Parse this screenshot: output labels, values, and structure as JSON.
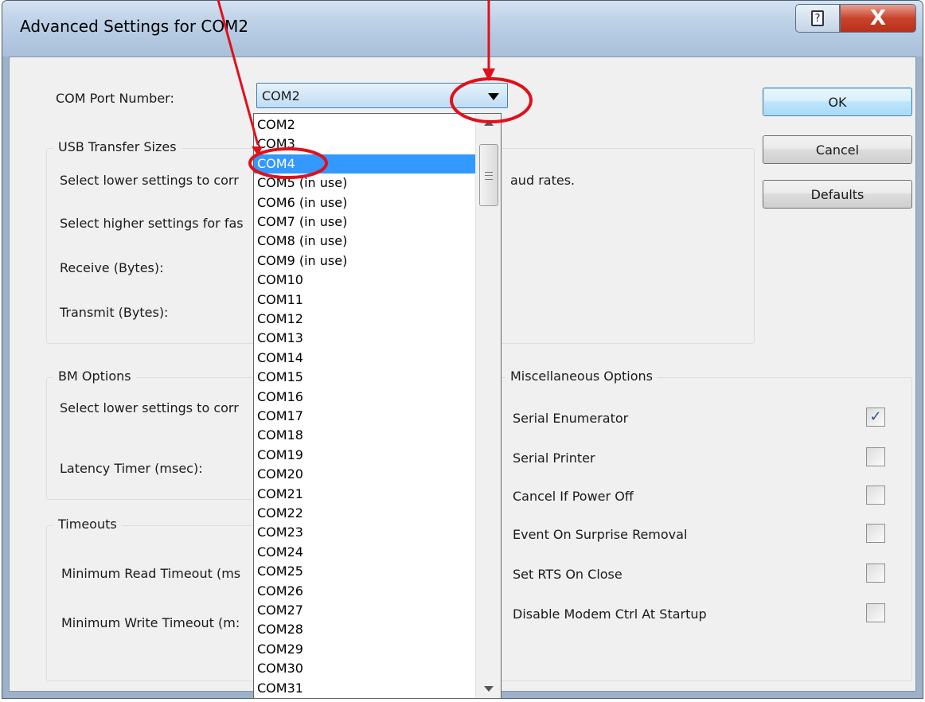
{
  "window": {
    "title": "Advanced Settings for COM2",
    "help_icon": "help-icon",
    "close_icon": "close-icon",
    "help_glyph": "?",
    "close_glyph": "X"
  },
  "com_port": {
    "label": "COM Port Number:",
    "selected": "COM2",
    "highlighted_option": "COM4",
    "options": [
      "COM2",
      "COM3",
      "COM4",
      "COM5 (in use)",
      "COM6 (in use)",
      "COM7 (in use)",
      "COM8 (in use)",
      "COM9 (in use)",
      "COM10",
      "COM11",
      "COM12",
      "COM13",
      "COM14",
      "COM15",
      "COM16",
      "COM17",
      "COM18",
      "COM19",
      "COM20",
      "COM21",
      "COM22",
      "COM23",
      "COM24",
      "COM25",
      "COM26",
      "COM27",
      "COM28",
      "COM29",
      "COM30",
      "COM31"
    ]
  },
  "buttons": {
    "ok": "OK",
    "cancel": "Cancel",
    "defaults": "Defaults"
  },
  "usb": {
    "title": "USB Transfer Sizes",
    "line1": "Select lower settings to corr",
    "line1_tail": "aud rates.",
    "line2": "Select higher settings for fas",
    "receive": "Receive (Bytes):",
    "transmit": "Transmit (Bytes):"
  },
  "bm": {
    "title": "BM Options",
    "line1": "Select lower settings to corr",
    "latency": "Latency Timer (msec):"
  },
  "timeouts": {
    "title": "Timeouts",
    "read": "Minimum Read Timeout (ms",
    "write": "Minimum Write Timeout (m:"
  },
  "misc": {
    "title": "Miscellaneous Options",
    "options": [
      {
        "label": "Serial Enumerator",
        "checked": true
      },
      {
        "label": "Serial Printer",
        "checked": false
      },
      {
        "label": "Cancel If Power Off",
        "checked": false
      },
      {
        "label": "Event On Surprise Removal",
        "checked": false
      },
      {
        "label": "Set RTS On Close",
        "checked": false
      },
      {
        "label": "Disable Modem Ctrl At Startup",
        "checked": false
      }
    ],
    "check_glyph": "✓"
  },
  "annotations": {
    "color": "#e0101b"
  }
}
